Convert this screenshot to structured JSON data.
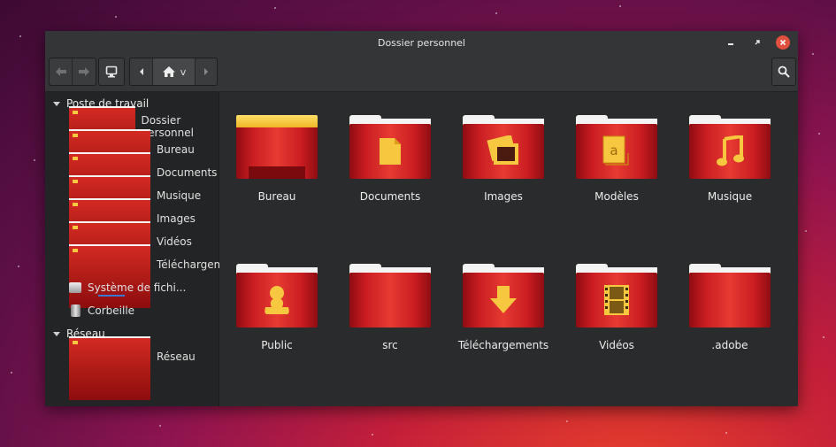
{
  "window": {
    "title": "Dossier personnel"
  },
  "toolbar": {
    "location_label": "v"
  },
  "sidebar": {
    "sections": [
      {
        "label": "Poste de travail",
        "items": [
          {
            "label": "Dossier personnel",
            "icon": "home-folder-icon"
          },
          {
            "label": "Bureau",
            "icon": "desktop-folder-icon"
          },
          {
            "label": "Documents",
            "icon": "documents-folder-icon"
          },
          {
            "label": "Musique",
            "icon": "music-folder-icon"
          },
          {
            "label": "Images",
            "icon": "pictures-folder-icon"
          },
          {
            "label": "Vidéos",
            "icon": "videos-folder-icon"
          },
          {
            "label": "Téléchargements",
            "icon": "downloads-folder-icon"
          },
          {
            "label": "Système de fichi...",
            "icon": "drive-icon"
          },
          {
            "label": "Corbeille",
            "icon": "trash-icon"
          }
        ]
      },
      {
        "label": "Réseau",
        "items": [
          {
            "label": "Réseau",
            "icon": "network-folder-icon"
          }
        ]
      }
    ]
  },
  "files": [
    {
      "label": "Bureau",
      "icon": "desktop-folder-icon"
    },
    {
      "label": "Documents",
      "icon": "documents-folder-icon"
    },
    {
      "label": "Images",
      "icon": "pictures-folder-icon"
    },
    {
      "label": "Modèles",
      "icon": "templates-folder-icon"
    },
    {
      "label": "Musique",
      "icon": "music-folder-icon"
    },
    {
      "label": "Public",
      "icon": "public-folder-icon"
    },
    {
      "label": "src",
      "icon": "folder-icon"
    },
    {
      "label": "Téléchargements",
      "icon": "downloads-folder-icon"
    },
    {
      "label": "Vidéos",
      "icon": "videos-folder-icon"
    },
    {
      "label": ".adobe",
      "icon": "folder-icon"
    }
  ],
  "colors": {
    "folder_red": "#c91d22",
    "emblem_yellow": "#f7c740",
    "window_bg": "#2a2b2c",
    "sidebar_bg": "#232425"
  }
}
